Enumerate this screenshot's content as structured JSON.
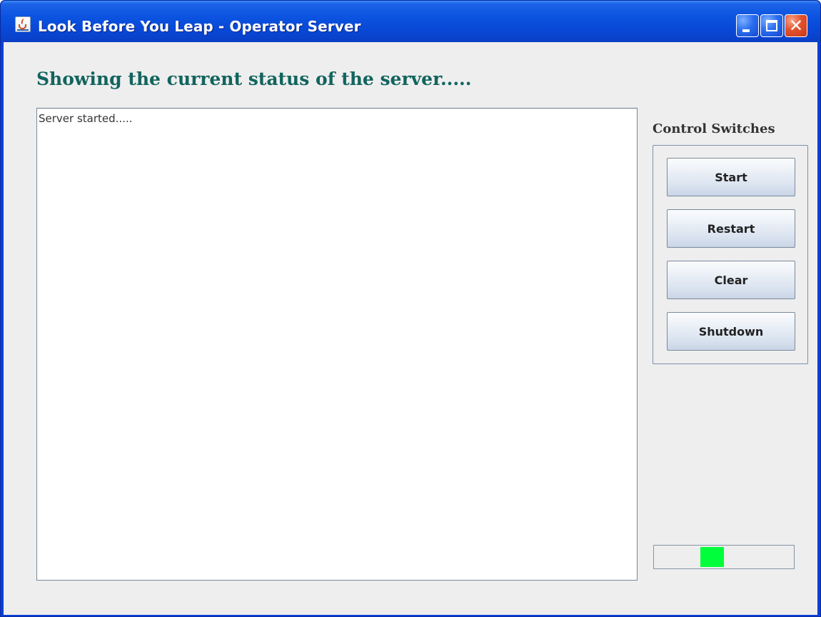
{
  "window": {
    "title": "Look Before You Leap - Operator Server",
    "icons": {
      "app": "java-icon",
      "minimize": "minimize-icon",
      "maximize": "maximize-icon",
      "close": "close-icon"
    },
    "close_glyph": "✕"
  },
  "main": {
    "heading": "Showing the current status of the server.....",
    "log_text": "Server started....."
  },
  "controls": {
    "title": "Control Switches",
    "buttons": {
      "start": "Start",
      "restart": "Restart",
      "clear": "Clear",
      "shutdown": "Shutdown"
    }
  },
  "activity_indicator": {
    "type": "indeterminate",
    "position_fraction": 0.33,
    "width_fraction": 0.17
  },
  "colors": {
    "heading": "#12645e",
    "indicator": "#00ff3a",
    "titlebar": "#0b53e0",
    "close_button": "#e2512c"
  }
}
